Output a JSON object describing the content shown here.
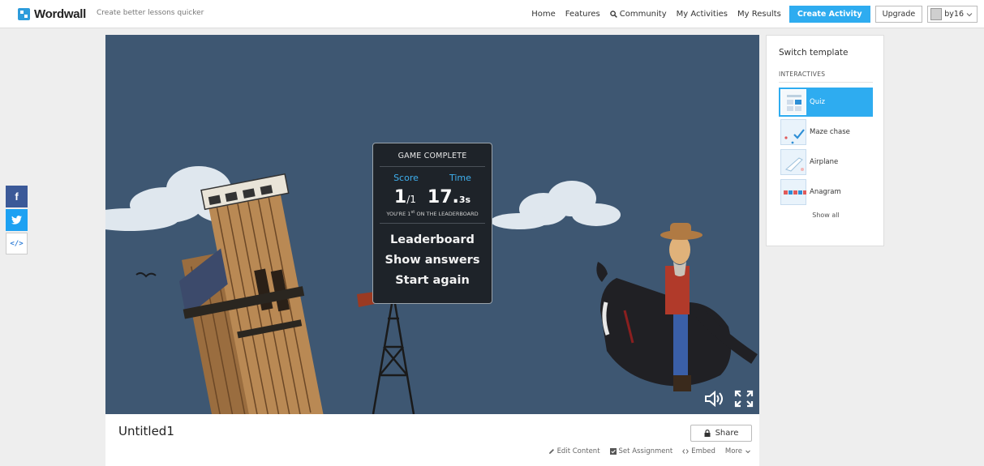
{
  "app": {
    "logo": "Wordwall",
    "tagline": "Create better lessons quicker"
  },
  "nav": {
    "home": "Home",
    "features": "Features",
    "community": "Community",
    "my_activities": "My Activities",
    "my_results": "My Results",
    "create_activity": "Create Activity",
    "upgrade": "Upgrade",
    "username": "by16"
  },
  "social": {
    "facebook": "f",
    "embed": "</>"
  },
  "game": {
    "panel_title": "GAME COMPLETE",
    "score_label": "Score",
    "time_label": "Time",
    "score_value": "1",
    "score_total": "/1",
    "time_value": "17.",
    "time_decimal": "3s",
    "rank_prefix": "YOU'RE 1",
    "rank_sup": "st",
    "rank_suffix": " ON THE LEADERBOARD",
    "leaderboard": "Leaderboard",
    "show_answers": "Show answers",
    "start_again": "Start again"
  },
  "activity": {
    "title": "Untitled1",
    "share": "Share",
    "edit_content": "Edit Content",
    "set_assignment": "Set Assignment",
    "embed": "Embed",
    "more": "More"
  },
  "templates": {
    "title": "Switch template",
    "category": "INTERACTIVES",
    "items": [
      {
        "label": "Quiz",
        "active": true
      },
      {
        "label": "Maze chase",
        "active": false
      },
      {
        "label": "Airplane",
        "active": false
      },
      {
        "label": "Anagram",
        "active": false
      }
    ],
    "show_all": "Show all"
  },
  "colors": {
    "accent": "#2eacf0",
    "game_background": "#3e5772",
    "facebook": "#3b5998",
    "twitter": "#1da1f2"
  },
  "icons": [
    "search-icon",
    "user-avatar-icon",
    "chevron-down-icon",
    "facebook-icon",
    "twitter-icon",
    "code-icon",
    "sound-icon",
    "fullscreen-icon",
    "lock-icon",
    "pencil-icon",
    "checkbox-icon"
  ]
}
